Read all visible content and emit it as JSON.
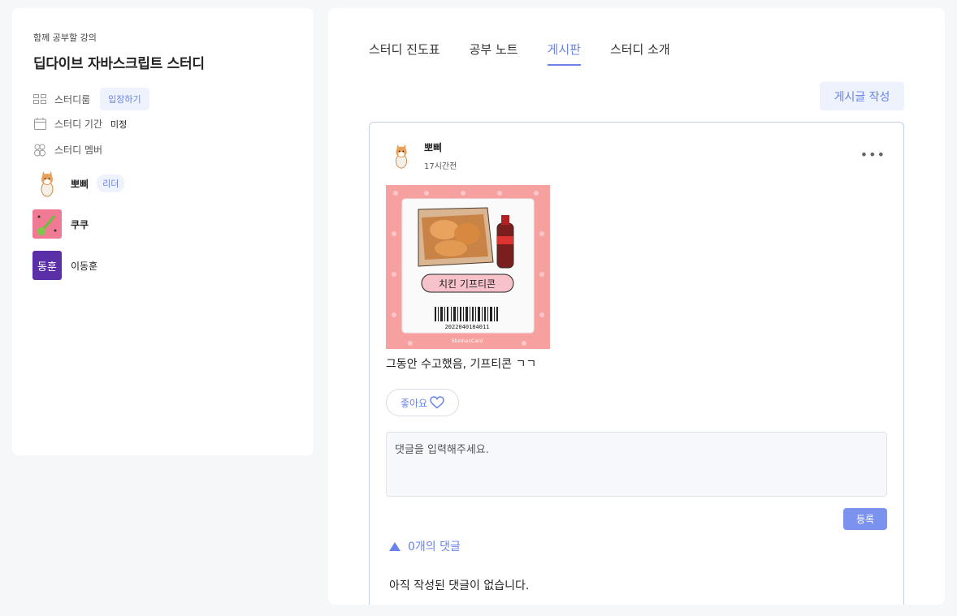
{
  "sidebar": {
    "subtitle": "함께 공부할 강의",
    "title": "딥다이브 자바스크립트 스터디",
    "room_label": "스터디룸",
    "enter_button": "입장하기",
    "period_label": "스터디 기간",
    "period_value": "미정",
    "members_label": "스터디 멤버",
    "members": [
      {
        "name": "뽀삐",
        "badge": "리더"
      },
      {
        "name": "쿠쿠"
      },
      {
        "name": "이동훈",
        "avatar_text": "동훈"
      }
    ]
  },
  "tabs": [
    "스터디 진도표",
    "공부 노트",
    "게시판",
    "스터디 소개"
  ],
  "active_tab": "게시판",
  "write_button": "게시글 작성",
  "post": {
    "author": "뽀삐",
    "time": "17시간전",
    "image_text": "치킨 기프티콘",
    "barcode_number": "2022040184011",
    "image_brand": "ShinhanCard",
    "caption": "그동안 수고했음, 기프티콘 ㄱㄱ",
    "like_label": "좋아요",
    "comment_placeholder": "댓글을 입력해주세요.",
    "submit_label": "등록",
    "comment_toggle": "0개의 댓글",
    "no_comments": "아직 작성된 댓글이 없습니다."
  },
  "colors": {
    "accent": "#6a83e8",
    "accent_bg": "#eef2fd",
    "page_bg": "#f6f7f8"
  }
}
